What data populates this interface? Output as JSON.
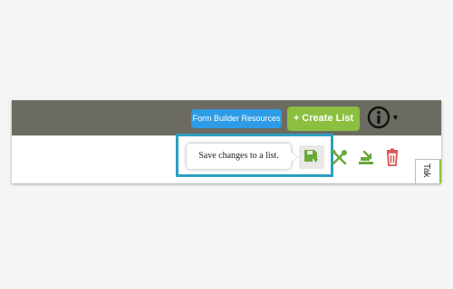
{
  "topbar": {
    "resources_label": "Form Builder Resources",
    "create_label": "+ Create List",
    "info_icon": "info-circle-icon"
  },
  "tooltip": {
    "text": "Save changes to a list."
  },
  "toolbar": {
    "icons": [
      "save-icon",
      "wrench-icon",
      "export-icon",
      "trash-icon"
    ]
  },
  "side_tab": {
    "label": "Tak"
  },
  "colors": {
    "topbar": "#6b6b62",
    "resources_button": "#2e9be6",
    "create_button": "#8cbf3f",
    "highlight": "#2c9fc0",
    "icon_green": "#6aa83a",
    "trash_red": "#d9534f"
  }
}
